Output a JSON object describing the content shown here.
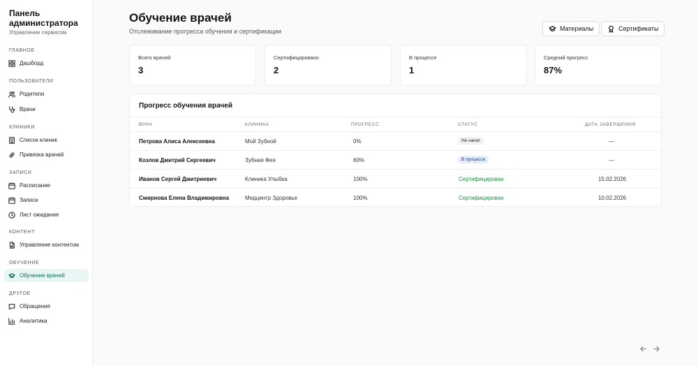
{
  "sidebar": {
    "title_line1": "Панель",
    "title_line2": "администратора",
    "subtitle": "Управление сервисом",
    "sections": [
      {
        "label": "ГЛАВНОЕ"
      },
      {
        "label": "ПОЛЬЗОВАТЕЛИ"
      },
      {
        "label": "КЛИНИКИ"
      },
      {
        "label": "ЗАПИСИ"
      },
      {
        "label": "КОНТЕНТ"
      },
      {
        "label": "ОБУЧЕНИЕ"
      },
      {
        "label": "ДРУГОЕ"
      }
    ],
    "items": [
      {
        "label": "Дашборд",
        "icon": "dashboard-icon"
      },
      {
        "label": "Родители",
        "icon": "users-icon"
      },
      {
        "label": "Врачи",
        "icon": "stethoscope-icon"
      },
      {
        "label": "Список клиник",
        "icon": "building-icon"
      },
      {
        "label": "Привязка врачей",
        "icon": "link-icon"
      },
      {
        "label": "Расписание",
        "icon": "calendar-icon"
      },
      {
        "label": "Записи",
        "icon": "calendar-check-icon"
      },
      {
        "label": "Лист ожидания",
        "icon": "clock-icon"
      },
      {
        "label": "Управление контентом",
        "icon": "document-icon"
      },
      {
        "label": "Обучение врачей",
        "icon": "graduation-cap-icon"
      },
      {
        "label": "Обращения",
        "icon": "chat-icon"
      },
      {
        "label": "Аналитика",
        "icon": "bar-chart-icon"
      }
    ],
    "active_color": "#0f6b5c"
  },
  "header": {
    "title": "Обучение врачей",
    "subtitle": "Отслеживание прогресса обучения и сертификации",
    "materials_label": "Материалы",
    "certificates_label": "Сертификаты"
  },
  "stats": [
    {
      "label": "Всего врачей",
      "value": "3"
    },
    {
      "label": "Сертифицировано",
      "value": "2"
    },
    {
      "label": "В процессе",
      "value": "1"
    },
    {
      "label": "Средний прогресс",
      "value": "87%"
    }
  ],
  "table": {
    "title": "Прогресс обучения врачей",
    "columns": [
      "ВРАЧ",
      "КЛИНИКА",
      "ПРОГРЕСС",
      "СТАТУС",
      "ДАТА ЗАВЕРШЕНИЯ"
    ],
    "rows": [
      {
        "doctor": "Петрова Алиса Алексеевна",
        "clinic": "Мой Зубной",
        "progress": "0%",
        "status": "Не начат",
        "date": "—"
      },
      {
        "doctor": "Козлов Дмитрий Сергеевич",
        "clinic": "Зубная Фея",
        "progress": "60%",
        "status": "В процессе",
        "date": "—"
      },
      {
        "doctor": "Иванов Сергей Дмитриевич",
        "clinic": "Клиника Улыбка",
        "progress": "100%",
        "status": "Сертифицирован",
        "date": "15.02.2026"
      },
      {
        "doctor": "Смирнова Елена Владимировна",
        "clinic": "Медцентр Здоровье",
        "progress": "100%",
        "status": "Сертифицирован",
        "date": "10.02.2026"
      }
    ],
    "status_colors": {
      "not_started": "#f1f1f1",
      "in_progress": "#e3ecfb",
      "certified": "#1a8f3c"
    }
  }
}
